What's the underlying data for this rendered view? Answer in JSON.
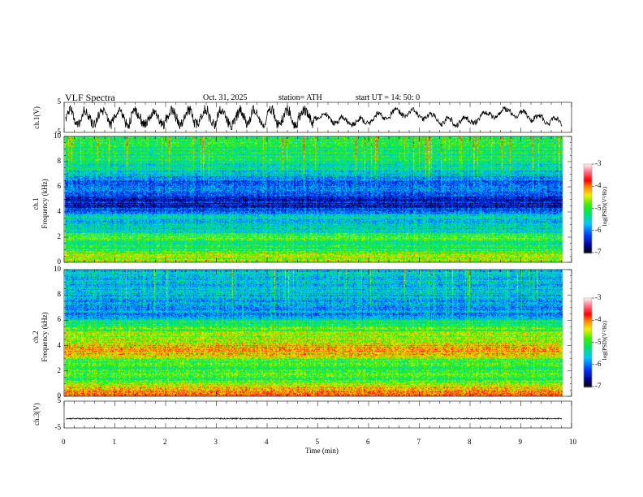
{
  "header": {
    "title": "VLF  Spectra",
    "date": "Oct. 31, 2025",
    "station": "station= ATH",
    "start": "start  UT  =    14: 50: 0"
  },
  "colors": {
    "waveform": "#000000",
    "axis": "#000000"
  },
  "chart_data": [
    {
      "type": "line",
      "name": "ch1-waveform",
      "ylabel": "ch.1(V)",
      "ylim": [
        -5,
        5
      ],
      "yticks": [
        "5",
        "-5"
      ],
      "xlim": [
        0,
        10
      ],
      "note_values": "noisy signal roughly between -4 and 4 V, quieter after 5 min"
    },
    {
      "type": "heatmap",
      "name": "ch1-spectrogram",
      "ylabel": "ch.1\nFrequency  (kHz)",
      "ylabel_line1": "ch.1",
      "ylabel_line2": "Frequency  (kHz)",
      "ylim": [
        0,
        10
      ],
      "yticks": [
        "0",
        "2",
        "4",
        "6",
        "8",
        "10"
      ],
      "xlim": [
        0,
        10
      ],
      "colorbar": {
        "label": "log(PSD)(V²/Hz)",
        "range": [
          -7,
          -3
        ],
        "ticks": [
          "-3",
          "-4",
          "-5",
          "-6",
          "-7"
        ]
      },
      "freq_profile_khz": [
        0,
        0.5,
        1,
        1.5,
        2,
        2.5,
        3,
        3.5,
        4,
        4.5,
        5,
        5.5,
        6,
        6.5,
        7,
        8,
        9,
        10
      ],
      "log_psd_profile": [
        -4.6,
        -4.7,
        -5.0,
        -5.2,
        -4.8,
        -5.4,
        -5.6,
        -5.5,
        -6.0,
        -6.4,
        -6.5,
        -6.2,
        -6.0,
        -6.1,
        -5.6,
        -5.3,
        -5.2,
        -5.0
      ]
    },
    {
      "type": "heatmap",
      "name": "ch2-spectrogram",
      "ylabel_line1": "ch.2",
      "ylabel_line2": "Frequency  (kHz)",
      "ylim": [
        0,
        10
      ],
      "yticks": [
        "0",
        "2",
        "4",
        "6",
        "8",
        "10"
      ],
      "xlim": [
        0,
        10
      ],
      "colorbar": {
        "label": "log(PSD)(V²/Hz)",
        "range": [
          -7,
          -3
        ],
        "ticks": [
          "-3",
          "-4",
          "-5",
          "-6",
          "-7"
        ]
      },
      "freq_profile_khz": [
        0,
        0.5,
        1,
        1.5,
        2,
        2.5,
        3,
        3.5,
        4,
        4.5,
        5,
        5.5,
        6,
        6.5,
        7,
        8,
        9,
        10
      ],
      "log_psd_profile": [
        -3.6,
        -4.0,
        -4.6,
        -5.0,
        -4.9,
        -5.0,
        -4.8,
        -4.1,
        -4.2,
        -4.6,
        -4.7,
        -5.0,
        -5.3,
        -5.8,
        -5.9,
        -5.7,
        -5.6,
        -5.5
      ]
    },
    {
      "type": "line",
      "name": "ch3-waveform",
      "ylabel": "ch.3(V)",
      "ylim": [
        -5,
        5
      ],
      "yticks": [
        "5",
        "-5"
      ],
      "xlim": [
        0,
        10
      ],
      "constant_value": -1.5
    }
  ],
  "xaxis": {
    "label": "Time  (min)",
    "ticks": [
      "0",
      "1",
      "2",
      "3",
      "4",
      "5",
      "6",
      "7",
      "8",
      "9",
      "10"
    ]
  }
}
